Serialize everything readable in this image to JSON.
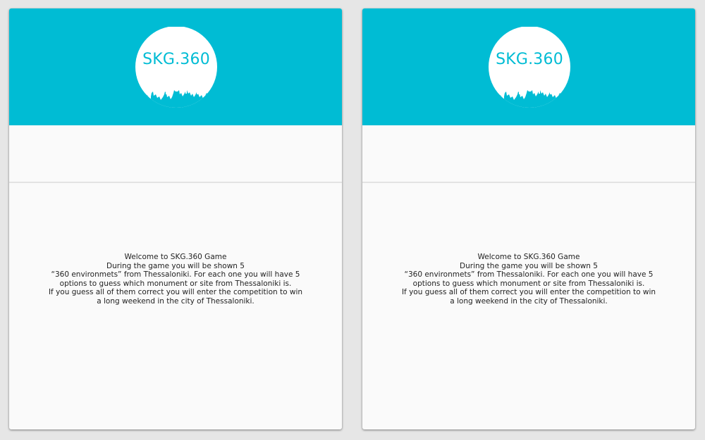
{
  "colors": {
    "header_bg": "#00bcd4",
    "logo_circle": "#ffffff",
    "logo_text": "#00bcd4",
    "page_bg": "#e6e6e6",
    "card_bg": "#fafafa"
  },
  "panels": [
    {
      "logo_text": "SKG.360",
      "intro_lines": [
        "Welcome to SKG.360 Game",
        "During the game you will be shown 5",
        "“360 environmets” from Thessaloniki. For each one you will have 5",
        "options to guess which monument or site from Thessaloniki is.",
        "If you guess all of them correct you will enter the competition to win",
        "a long weekend in the city of Thessaloniki."
      ]
    },
    {
      "logo_text": "SKG.360",
      "intro_lines": [
        "Welcome to SKG.360 Game",
        "During the game you will be shown 5",
        "“360 environmets” from Thessaloniki. For each one you will have 5",
        "options to guess which monument or site from Thessaloniki is.",
        "If you guess all of them correct you will enter the competition to win",
        "a long weekend in the city of Thessaloniki."
      ]
    }
  ]
}
